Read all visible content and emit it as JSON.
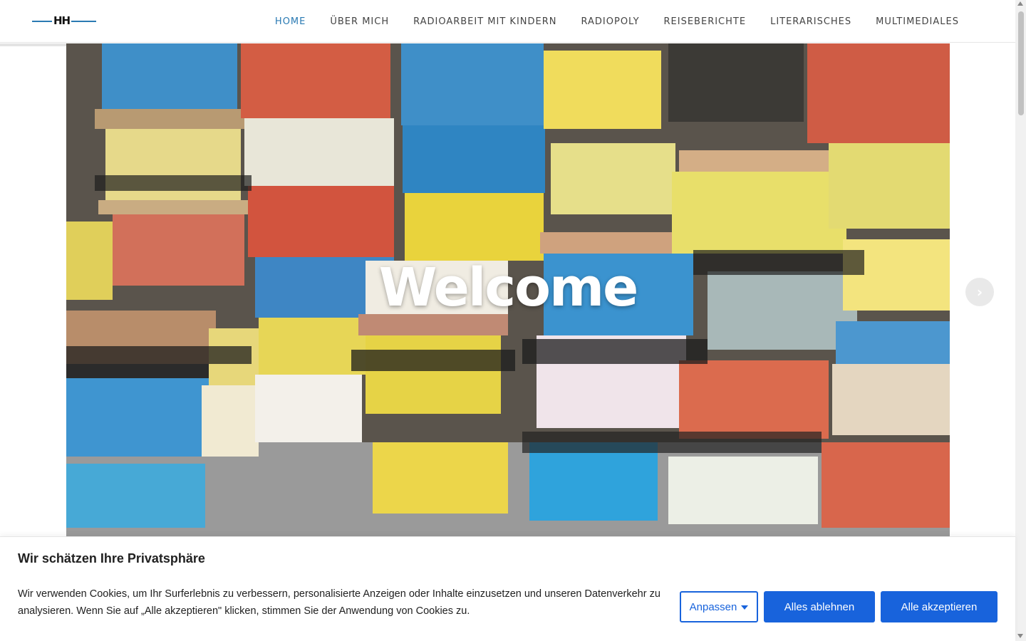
{
  "header": {
    "logo_text": "HH",
    "nav": [
      {
        "label": "HOME",
        "active": true
      },
      {
        "label": "ÜBER MICH",
        "active": false
      },
      {
        "label": "RADIOARBEIT MIT KINDERN",
        "active": false
      },
      {
        "label": "RADIOPOLY",
        "active": false
      },
      {
        "label": "REISEBERICHTE",
        "active": false
      },
      {
        "label": "LITERARISCHES",
        "active": false
      },
      {
        "label": "MULTIMEDIALES",
        "active": false
      }
    ]
  },
  "hero": {
    "title": "Welcome",
    "next_icon": "chevron-right-icon"
  },
  "cookie": {
    "title": "Wir schätzen Ihre Privatsphäre",
    "text": "Wir verwenden Cookies, um Ihr Surferlebnis zu verbessern, personalisierte Anzeigen oder Inhalte einzusetzen und unseren Datenverkehr zu analysieren. Wenn Sie auf „Alle akzeptieren\" klicken, stimmen Sie der Anwendung von Cookies zu.",
    "customize_label": "Anpassen",
    "reject_label": "Alles ablehnen",
    "accept_label": "Alle akzeptieren"
  },
  "colors": {
    "accent": "#2a7ab3",
    "button": "#1863dc"
  }
}
